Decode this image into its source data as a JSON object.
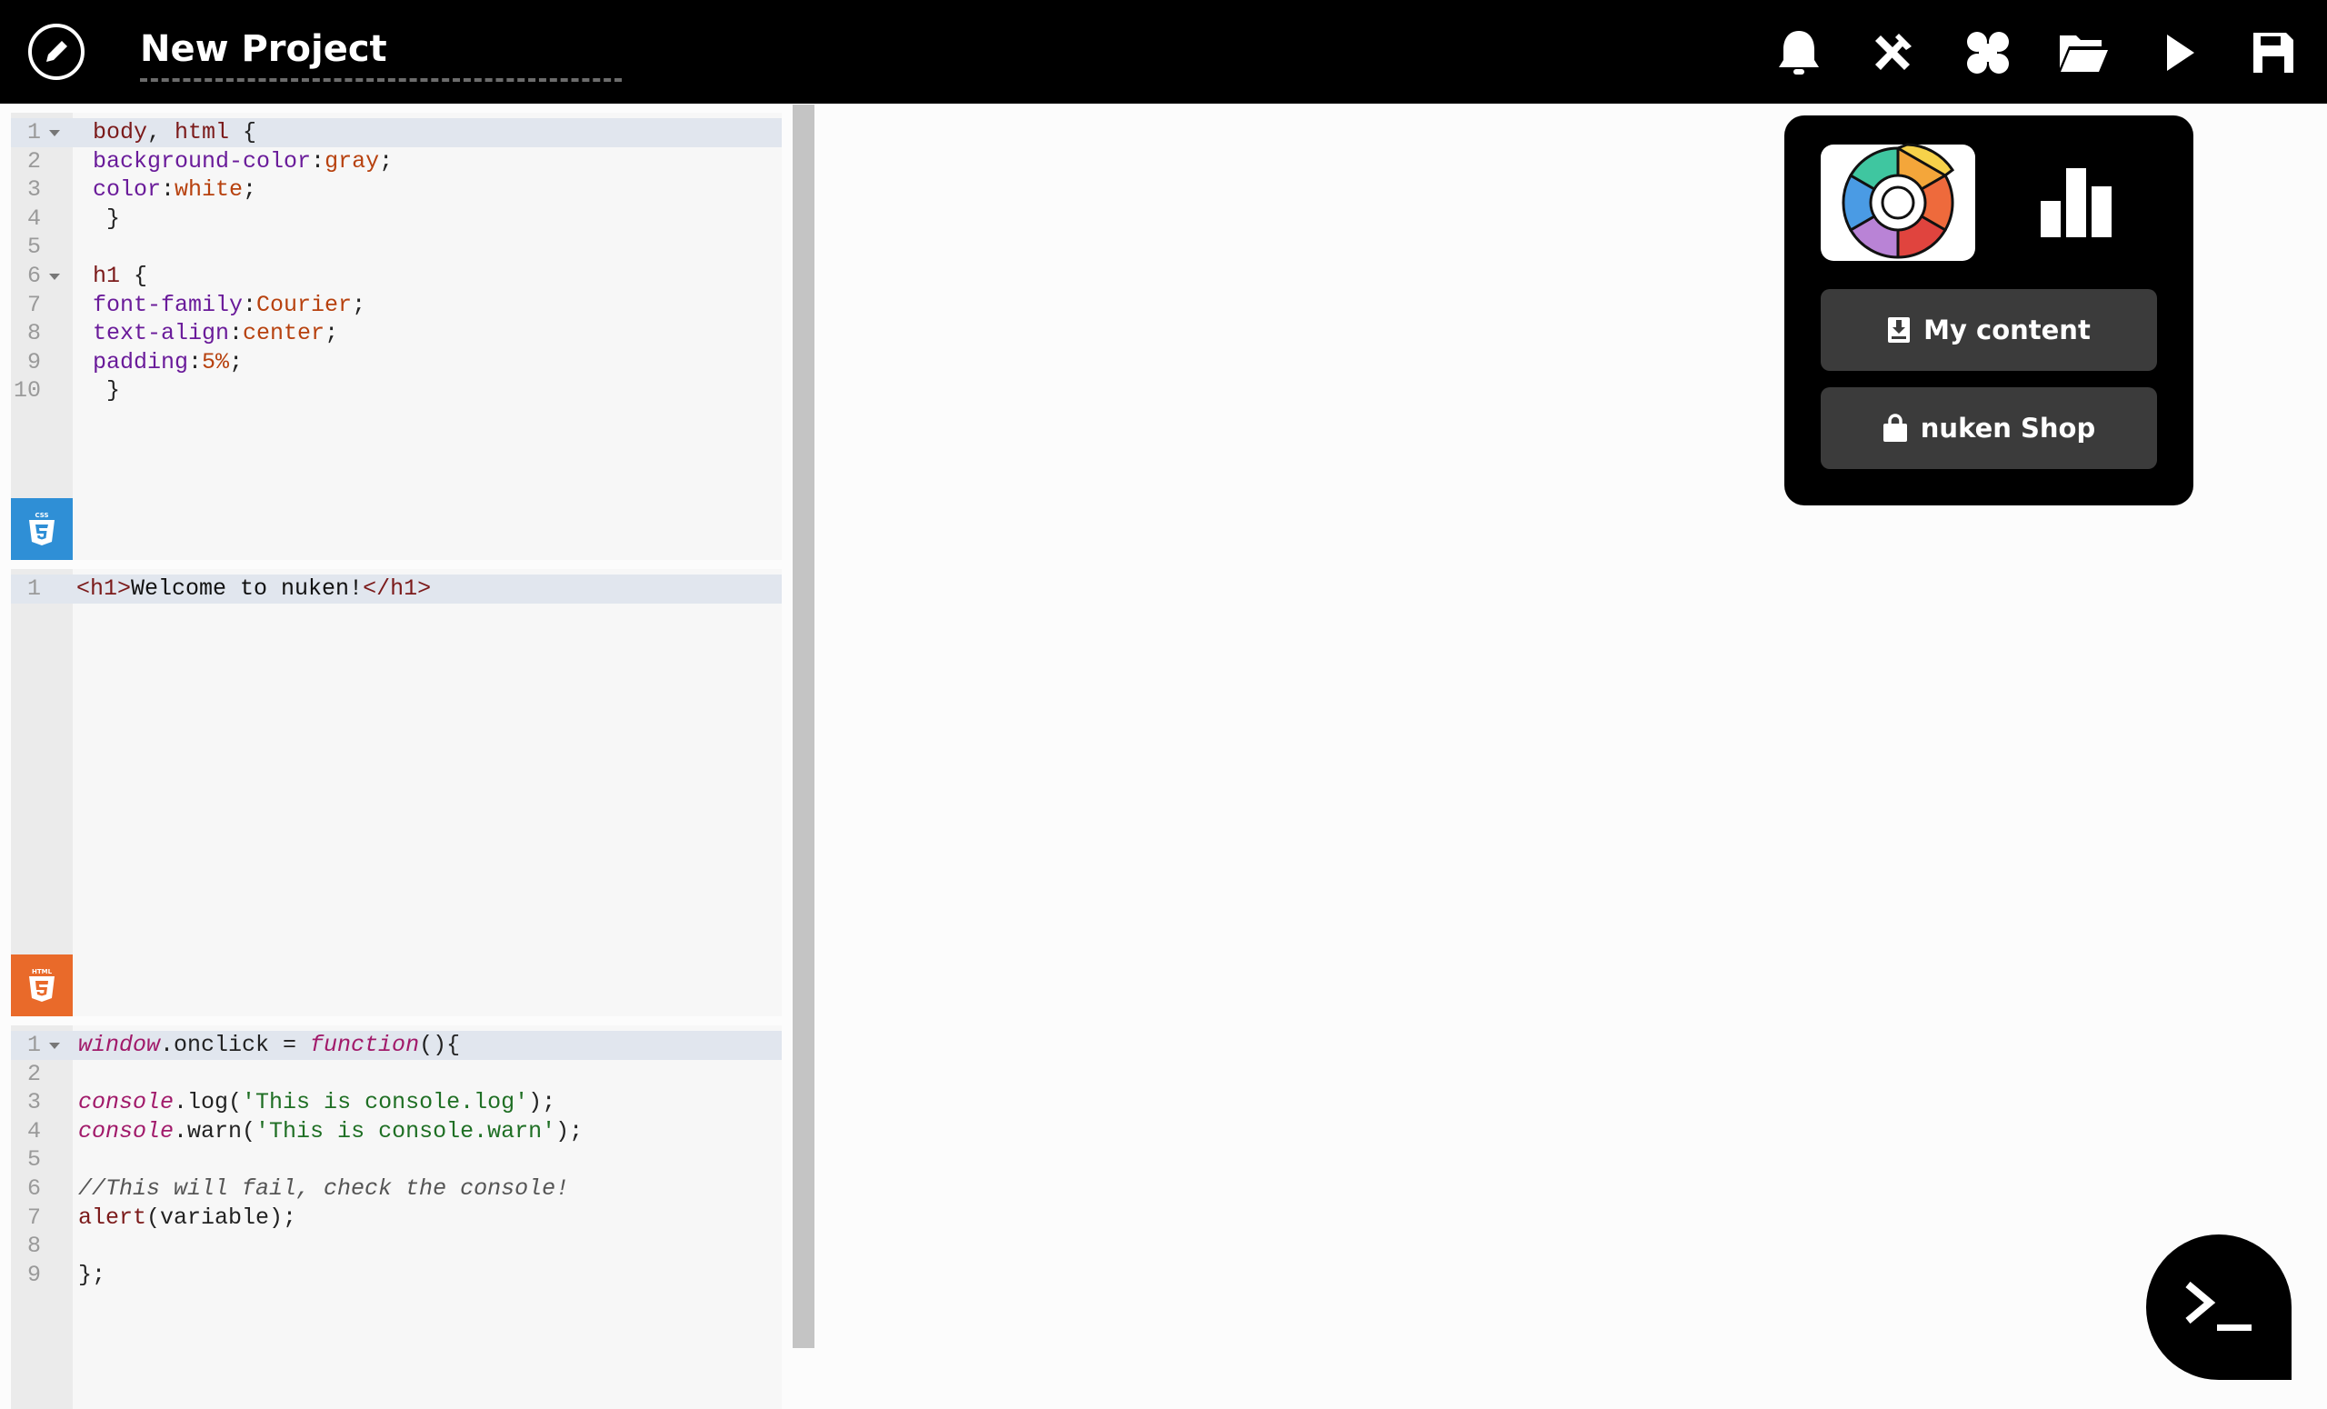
{
  "header": {
    "title": "New Project",
    "icons": [
      "edit-icon",
      "bell-icon",
      "tools-icon",
      "apps-icon",
      "folder-icon",
      "play-icon",
      "save-icon"
    ]
  },
  "css_editor": {
    "lines": [
      {
        "n": "1",
        "fold": true,
        "active": true,
        "parts": [
          [
            "kw-sel",
            "body"
          ],
          [
            "pun",
            ", "
          ],
          [
            "kw-sel",
            "html"
          ],
          [
            "pun",
            " {"
          ]
        ]
      },
      {
        "n": "2",
        "parts": [
          [
            "prop",
            "background-color"
          ],
          [
            "pun",
            ":"
          ],
          [
            "val",
            "gray"
          ],
          [
            "pun",
            ";"
          ]
        ]
      },
      {
        "n": "3",
        "parts": [
          [
            "prop",
            "color"
          ],
          [
            "pun",
            ":"
          ],
          [
            "val",
            "white"
          ],
          [
            "pun",
            ";"
          ]
        ]
      },
      {
        "n": "4",
        "parts": [
          [
            "pun",
            " }"
          ]
        ]
      },
      {
        "n": "5",
        "parts": []
      },
      {
        "n": "6",
        "fold": true,
        "parts": [
          [
            "kw-sel",
            "h1"
          ],
          [
            "pun",
            " {"
          ]
        ]
      },
      {
        "n": "7",
        "parts": [
          [
            "prop",
            "font-family"
          ],
          [
            "pun",
            ":"
          ],
          [
            "val",
            "Courier"
          ],
          [
            "pun",
            ";"
          ]
        ]
      },
      {
        "n": "8",
        "parts": [
          [
            "prop",
            "text-align"
          ],
          [
            "pun",
            ":"
          ],
          [
            "val",
            "center"
          ],
          [
            "pun",
            ";"
          ]
        ]
      },
      {
        "n": "9",
        "parts": [
          [
            "prop",
            "padding"
          ],
          [
            "pun",
            ":"
          ],
          [
            "val",
            "5%"
          ],
          [
            "pun",
            ";"
          ]
        ]
      },
      {
        "n": "10",
        "parts": [
          [
            "pun",
            " }"
          ]
        ]
      }
    ],
    "badge": "CSS"
  },
  "html_editor": {
    "lines": [
      {
        "n": "1",
        "active": true,
        "parts": [
          [
            "tag",
            "<h1>"
          ],
          [
            "txt",
            "Welcome to nuken!"
          ],
          [
            "tag",
            "</h1>"
          ]
        ]
      }
    ],
    "badge": "HTML"
  },
  "js_editor": {
    "lines": [
      {
        "n": "1",
        "fold": true,
        "active": true,
        "parts": [
          [
            "jsvar",
            "window"
          ],
          [
            "pun",
            ".onclick = "
          ],
          [
            "fn",
            "function"
          ],
          [
            "pun",
            "(){"
          ]
        ]
      },
      {
        "n": "2",
        "parts": []
      },
      {
        "n": "3",
        "parts": [
          [
            "jsvar",
            "console"
          ],
          [
            "pun",
            ".log("
          ],
          [
            "str",
            "'This is console.log'"
          ],
          [
            "pun",
            ");"
          ]
        ]
      },
      {
        "n": "4",
        "parts": [
          [
            "jsvar",
            "console"
          ],
          [
            "pun",
            ".warn("
          ],
          [
            "str",
            "'This is console.warn'"
          ],
          [
            "pun",
            ");"
          ]
        ]
      },
      {
        "n": "5",
        "parts": []
      },
      {
        "n": "6",
        "parts": [
          [
            "com",
            "//This will fail, check the console!"
          ]
        ]
      },
      {
        "n": "7",
        "parts": [
          [
            "tag",
            "alert"
          ],
          [
            "pun",
            "(variable);"
          ]
        ]
      },
      {
        "n": "8",
        "parts": []
      },
      {
        "n": "9",
        "parts": [
          [
            "pun",
            "};"
          ]
        ]
      }
    ]
  },
  "dropdown": {
    "my_content": "My content",
    "shop": "nuken Shop"
  },
  "colors": {
    "css_badge": "#2f8fd6",
    "html_badge": "#e96a2a",
    "topbar": "#000000",
    "dropdown_button": "#3b3b3b"
  }
}
